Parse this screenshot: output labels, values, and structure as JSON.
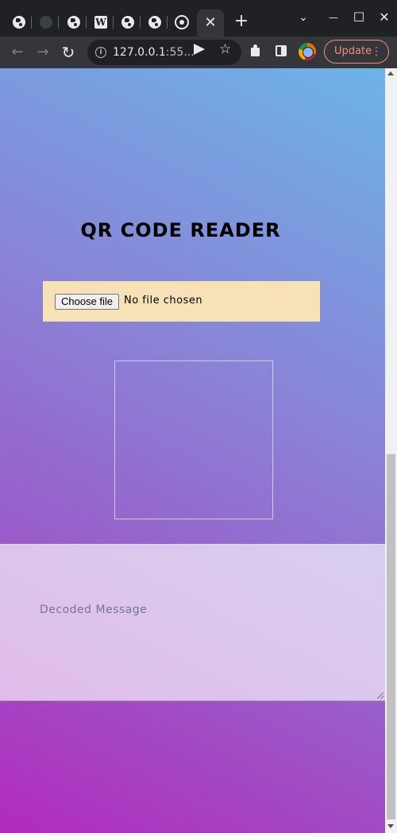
{
  "browser": {
    "tabs": [
      {
        "icon": "globe-icon"
      },
      {
        "icon": "github-icon"
      },
      {
        "icon": "globe-icon"
      },
      {
        "icon": "wikipedia-icon",
        "glyph": "W"
      },
      {
        "icon": "globe-icon"
      },
      {
        "icon": "globe-icon"
      },
      {
        "icon": "chrome-icon"
      },
      {
        "icon": "close-icon",
        "active": true
      }
    ],
    "new_tab": "+",
    "window": {
      "list": "⌄",
      "minimize": "—",
      "maximize": "☐",
      "close": "✕"
    },
    "close_glyph": "✕",
    "url_host": "127.0.0.1",
    "url_rest": ":55...",
    "update_label": "Update",
    "menu_glyph": "⋮",
    "back_glyph": "←",
    "forward_glyph": "→",
    "reload_glyph": "↻",
    "star_glyph": "☆",
    "info_glyph": "i"
  },
  "page": {
    "title": "QR CODE READER",
    "file_input": {
      "button_label": "Choose file",
      "status": "No file chosen"
    },
    "decoded_placeholder": "Decoded Message"
  },
  "colors": {
    "gradient_start": "#b12bbc",
    "gradient_end": "#6cb3e8",
    "file_box_bg": "#f6e2b6",
    "update_red": "#f28b82"
  }
}
